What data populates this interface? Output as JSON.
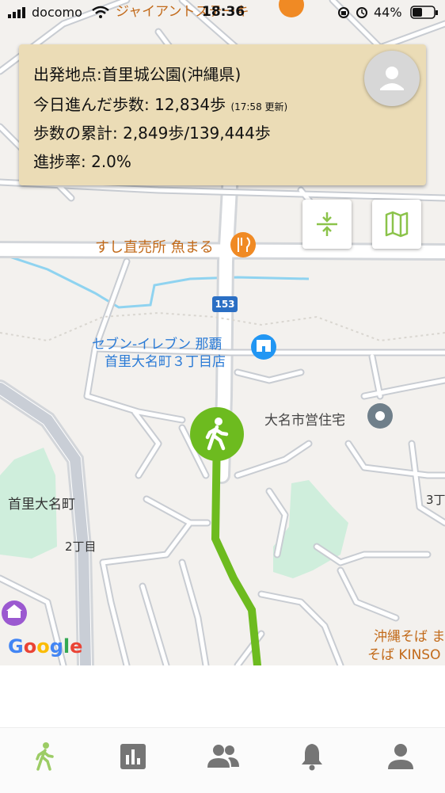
{
  "status_bar": {
    "carrier": "docomo",
    "time": "18:36",
    "battery": "44%"
  },
  "info_card": {
    "start_point": "出発地点:首里城公園(沖縄県)",
    "today_steps": "今日進んだ歩数: 12,834歩",
    "updated": "(17:58 更新)",
    "total_steps": "歩数の累計: 2,849歩/139,444歩",
    "progress": "進捗率: 2.0%"
  },
  "map": {
    "labels": {
      "giant_steak": "ジャイアントステーキ",
      "sushi": "すし直売所 魚まる",
      "route_number": "153",
      "seven_line1": "セブン-イレブン 那覇",
      "seven_line2": "首里大名町３丁目店",
      "housing": "大名市営住宅",
      "district": "首里大名町",
      "chome2": "2丁目",
      "chome3": "3丁",
      "soba_line1": "沖縄そば ま",
      "soba_line2": "そば KINSO"
    },
    "route_color": "#6dbb1f",
    "google_logo": "Google"
  },
  "tabs": [
    "walk-icon",
    "chart-icon",
    "group-icon",
    "bell-icon",
    "person-icon"
  ]
}
